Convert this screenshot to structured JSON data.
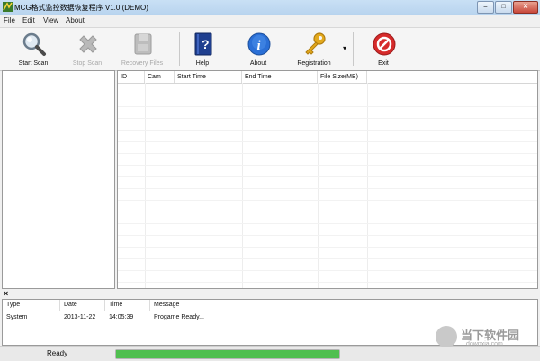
{
  "window": {
    "title": "MCG格式监控数据恢复程序 V1.0 (DEMO)",
    "minimize_label": "–",
    "maximize_label": "□",
    "close_label": "✕"
  },
  "menu": [
    "File",
    "Edit",
    "View",
    "About"
  ],
  "toolbar": {
    "start_scan": "Start Scan",
    "stop_scan": "Stop Scan",
    "recovery_files": "Recovery  Files",
    "help": "Help",
    "about": "About",
    "registration": "Registration",
    "exit": "Exit",
    "dropdown_arrow": "▾",
    "icons": [
      "search-icon",
      "stop-icon",
      "recovery-icon",
      "help-book-icon",
      "info-icon",
      "key-icon",
      "exit-icon"
    ]
  },
  "file_list": {
    "columns": [
      "ID",
      "Cam",
      "Start Time",
      "End Time",
      "File Size(MB)"
    ],
    "rows": []
  },
  "log": {
    "close_label": "×",
    "columns": [
      "Type",
      "Date",
      "Time",
      "Message"
    ],
    "rows": [
      {
        "type": "System",
        "date": "2013-11-22",
        "time": "14:05:39",
        "message": "Progame Ready..."
      }
    ]
  },
  "status": {
    "text": "Ready",
    "progress": 1.0
  },
  "watermark": {
    "text": "当下软件园",
    "sub": "downxia.com"
  },
  "colors": {
    "accent_blue": "#2a6fd6",
    "exit_red": "#d62b2b",
    "key_gold": "#e3a91c",
    "progress_green": "#4fbf4f"
  }
}
